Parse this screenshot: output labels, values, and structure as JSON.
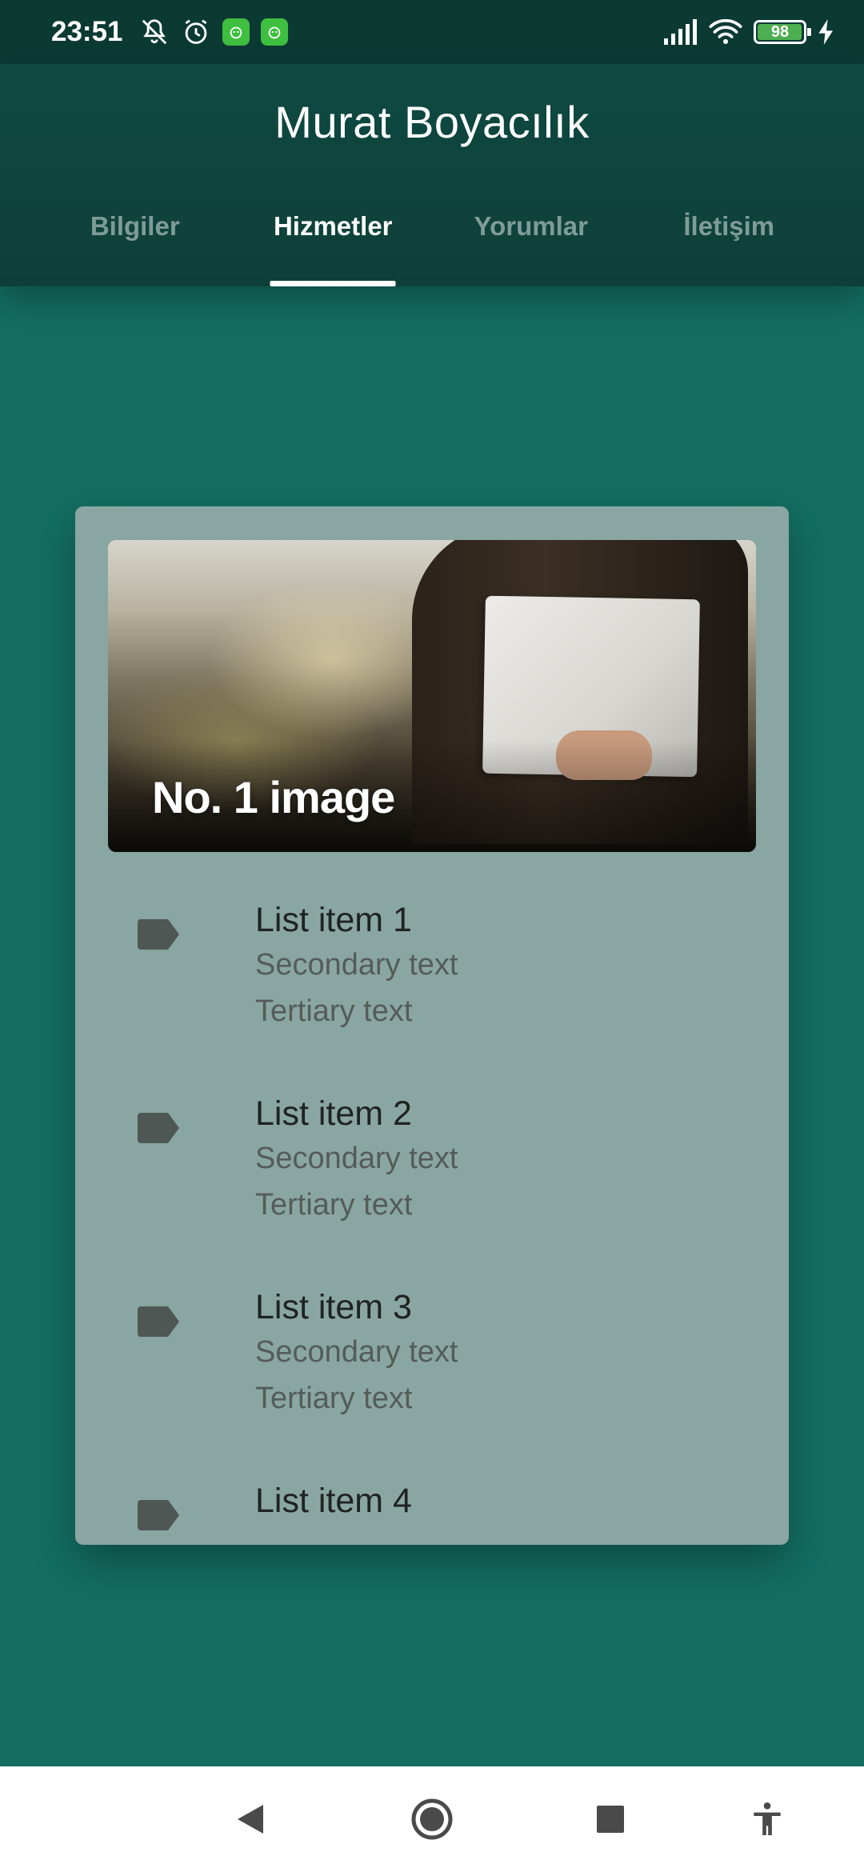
{
  "status_bar": {
    "time": "23:51",
    "battery_level": "98",
    "battery_fraction": 0.98,
    "icons": [
      "mute-notification-icon",
      "alarm-icon",
      "app-notification-icon",
      "app-notification-icon",
      "signal-icon",
      "wifi-icon",
      "battery-icon",
      "charging-icon"
    ]
  },
  "app_bar": {
    "title": "Murat Boyacılık",
    "tabs": [
      {
        "label": "Bilgiler",
        "active": false
      },
      {
        "label": "Hizmetler",
        "active": true
      },
      {
        "label": "Yorumlar",
        "active": false
      },
      {
        "label": "İletişim",
        "active": false
      }
    ]
  },
  "card": {
    "image_caption": "No. 1 image",
    "items": [
      {
        "primary": "List item 1",
        "secondary": "Secondary text",
        "tertiary": "Tertiary text",
        "icon": "label-icon"
      },
      {
        "primary": "List item 2",
        "secondary": "Secondary text",
        "tertiary": "Tertiary text",
        "icon": "label-icon"
      },
      {
        "primary": "List item 3",
        "secondary": "Secondary text",
        "tertiary": "Tertiary text",
        "icon": "label-icon"
      },
      {
        "primary": "List item 4",
        "icon": "label-icon"
      }
    ]
  },
  "nav_bar": {
    "buttons": [
      "back-icon",
      "home-icon",
      "recents-icon",
      "accessibility-icon"
    ]
  },
  "colors": {
    "background": "#136d62",
    "app_bar": "#0f4a42",
    "card": "#8aa6a2",
    "tab_active": "#ffffff",
    "tab_inactive": "#7f9c97"
  }
}
